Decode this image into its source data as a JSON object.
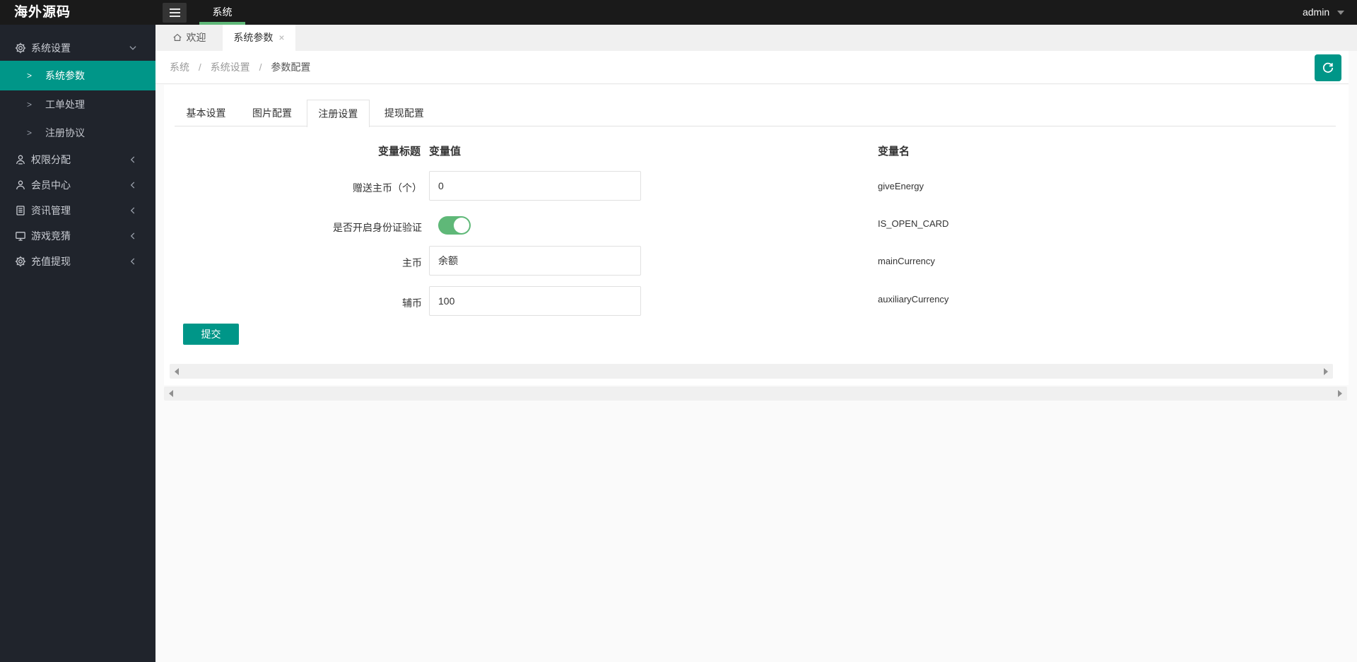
{
  "topbar": {
    "logo": "海外源码",
    "nav_item": "系统",
    "user": "admin"
  },
  "sidebar": {
    "groups": [
      {
        "label": "系统设置",
        "icon": "gear-icon",
        "state": "expanded",
        "children": [
          {
            "label": "系统参数",
            "active": true
          },
          {
            "label": "工单处理",
            "active": false
          },
          {
            "label": "注册协议",
            "active": false
          }
        ]
      },
      {
        "label": "权限分配",
        "icon": "user-permissions-icon",
        "state": "collapsed"
      },
      {
        "label": "会员中心",
        "icon": "user-icon",
        "state": "collapsed"
      },
      {
        "label": "资讯管理",
        "icon": "document-icon",
        "state": "collapsed"
      },
      {
        "label": "游戏竞猜",
        "icon": "monitor-icon",
        "state": "collapsed"
      },
      {
        "label": "充值提现",
        "icon": "gear-icon",
        "state": "collapsed"
      }
    ]
  },
  "tabstrip": {
    "tabs": [
      {
        "label": "欢迎",
        "icon": "home-icon",
        "active": false
      },
      {
        "label": "系统参数",
        "active": true,
        "closable": true,
        "close_glyph": "×"
      }
    ]
  },
  "breadcrumb": {
    "items": [
      "系统",
      "系统设置",
      "参数配置"
    ],
    "separator": "/"
  },
  "panel": {
    "tabs": [
      "基本设置",
      "图片配置",
      "注册设置",
      "提现配置"
    ],
    "active_tab": "注册设置",
    "columns": {
      "title": "变量标题",
      "value": "变量值",
      "name": "变量名"
    },
    "rows": [
      {
        "label": "赠送主币（个）",
        "control": "input",
        "value": "0",
        "name": "giveEnergy"
      },
      {
        "label": "是否开启身份证验证",
        "control": "toggle",
        "value": "on",
        "name": "IS_OPEN_CARD"
      },
      {
        "label": "主币",
        "control": "input",
        "value": "余额",
        "name": "mainCurrency"
      },
      {
        "label": "辅币",
        "control": "input",
        "value": "100",
        "name": "auxiliaryCurrency"
      }
    ],
    "submit_label": "提交"
  },
  "colors": {
    "teal": "#009688",
    "green": "#5FB878",
    "topbar_bg": "#1a1a1a",
    "sidebar_bg": "#20242C"
  }
}
